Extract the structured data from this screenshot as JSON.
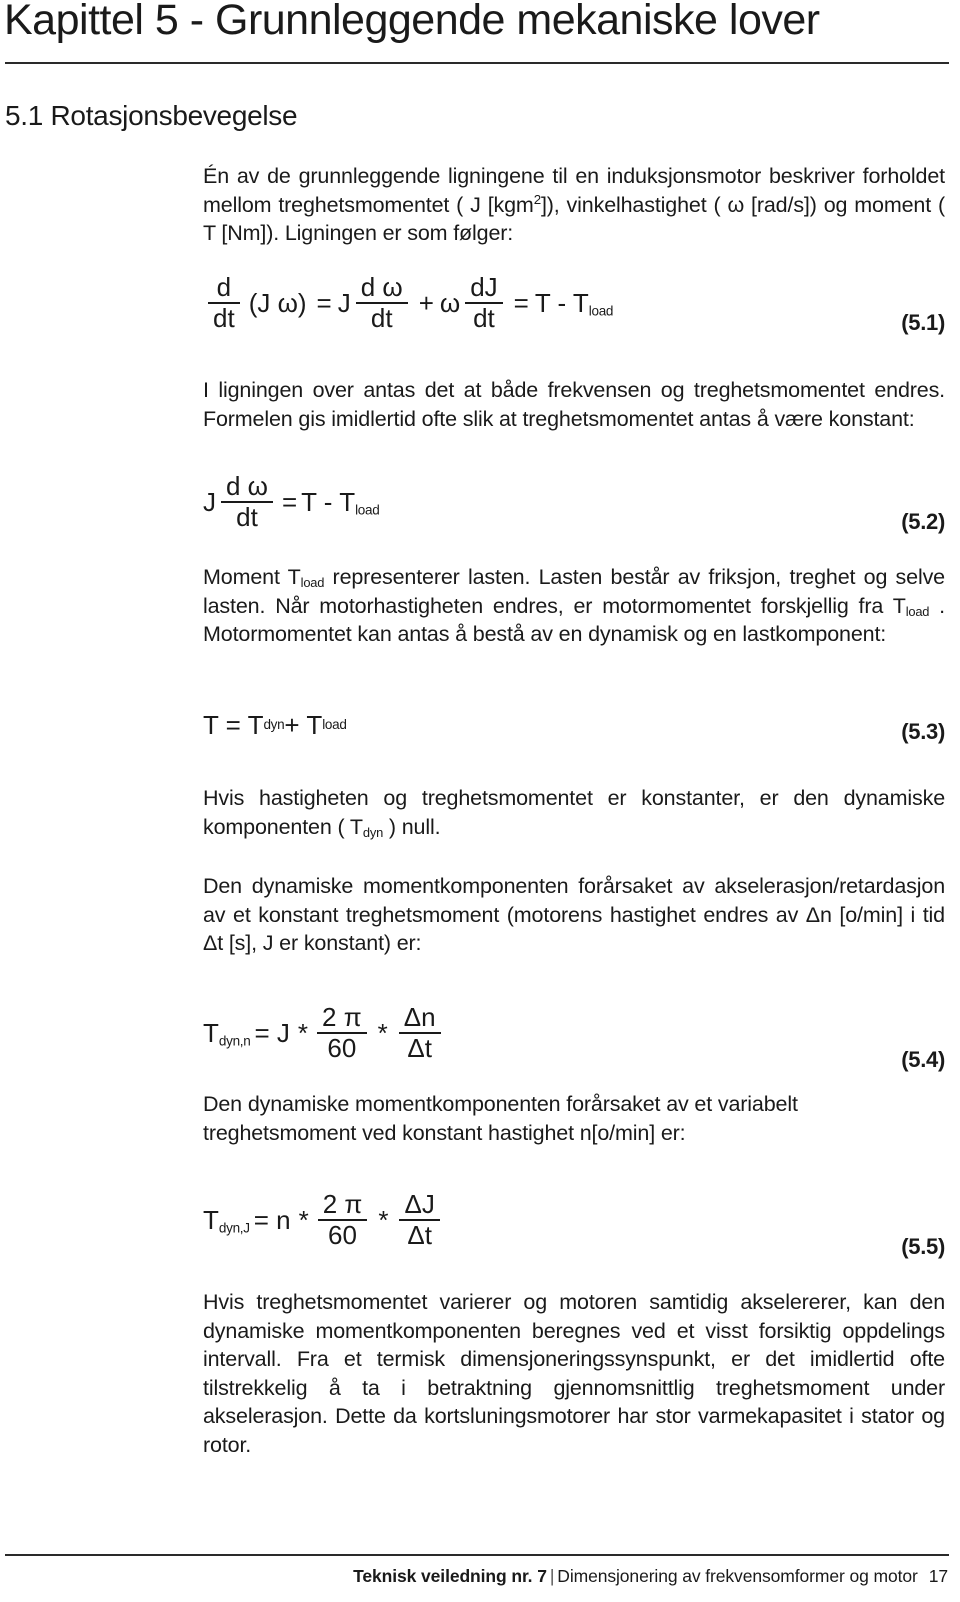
{
  "header": {
    "chapter_title": "Kapittel 5 - Grunnleggende mekaniske lover",
    "section_heading": "5.1 Rotasjonsbevegelse"
  },
  "body": {
    "para1_a": "Én av de grunnleggende ligningene til en induksjonsmotor beskriver forholdet mellom treghetsmomentet ( J [kgm",
    "para1_sup": "2",
    "para1_b": "]), vinkelhastighet ( ω [rad/s]) og moment ( T [Nm]). Ligningen er som følger:",
    "para2": "I ligningen over antas det at både frekvensen og treghetsmomentet endres. Formelen gis imidlertid ofte slik at treghetsmomentet antas å være konstant:",
    "para3_a": "Moment T",
    "para3_sub1": "load",
    "para3_b": " representerer lasten. Lasten består av friksjon, treghet og selve lasten. Når motorhastigheten endres, er motormomentet forskjellig fra T",
    "para3_sub2": "load",
    "para3_c": " . Motormomentet kan antas å bestå av en dynamisk og en lastkomponent:",
    "para4_a": "Hvis hastigheten og treghetsmomentet er konstanter, er den dynamiske komponenten ( T",
    "para4_sub": "dyn",
    "para4_b": " ) null.",
    "para5": "Den dynamiske momentkomponenten forårsaket av akselerasjon/retardasjon av et konstant treghetsmoment (motorens hastighet endres av Δn [o/min] i tid Δt [s], J er konstant) er:",
    "para6": "Den dynamiske momentkomponenten forårsaket av et variabelt treghetsmoment ved konstant hastighet n[o/min] er:",
    "para7": "Hvis treghetsmomentet varierer og motoren samtidig akselererer, kan den dynamiske momentkomponenten beregnes ved et visst forsiktig oppdelings intervall. Fra et termisk dimensjoneringssynspunkt, er det imidlertid ofte tilstrekkelig å ta i betraktning gjennomsnittlig treghetsmoment under akselerasjon. Dette da kortsluningsmotorer har stor varmekapasitet i stator og rotor."
  },
  "equations": {
    "eq1": {
      "number": "(5.1)",
      "f1_num": "d",
      "f1_den": "dt",
      "t1": "(J ω)",
      "t2": "=",
      "t3": "J",
      "f2_num": "d ω",
      "f2_den": "dt",
      "t4": "+",
      "t5": "ω",
      "f3_num": "dJ",
      "f3_den": "dt",
      "t6": "=",
      "t7": "T - T",
      "sub": "load"
    },
    "eq2": {
      "number": "(5.2)",
      "t1": "J",
      "f1_num": "d ω",
      "f1_den": "dt",
      "t2": "=",
      "t3": "T - T",
      "sub": "load"
    },
    "eq3": {
      "number": "(5.3)",
      "t1": "T = T",
      "sub1": "dyn",
      "t2": " + T",
      "sub2": "load"
    },
    "eq4": {
      "number": "(5.4)",
      "t1": "T",
      "sub1": "dyn,n",
      "t2": "= J",
      "star1": "*",
      "f1_num": "2 π",
      "f1_den": "60",
      "star2": "*",
      "f2_num": "Δn",
      "f2_den": "Δt"
    },
    "eq5": {
      "number": "(5.5)",
      "t1": "T",
      "sub1": "dyn,J",
      "t2": "= n",
      "star1": "*",
      "f1_num": "2 π",
      "f1_den": "60",
      "star2": "*",
      "f2_num": "ΔJ",
      "f2_den": "Δt"
    }
  },
  "footer": {
    "guide": "Teknisk veiledning nr. 7",
    "separator": "|",
    "subtitle": "Dimensjonering av frekvensomformer og motor",
    "page": "17"
  }
}
